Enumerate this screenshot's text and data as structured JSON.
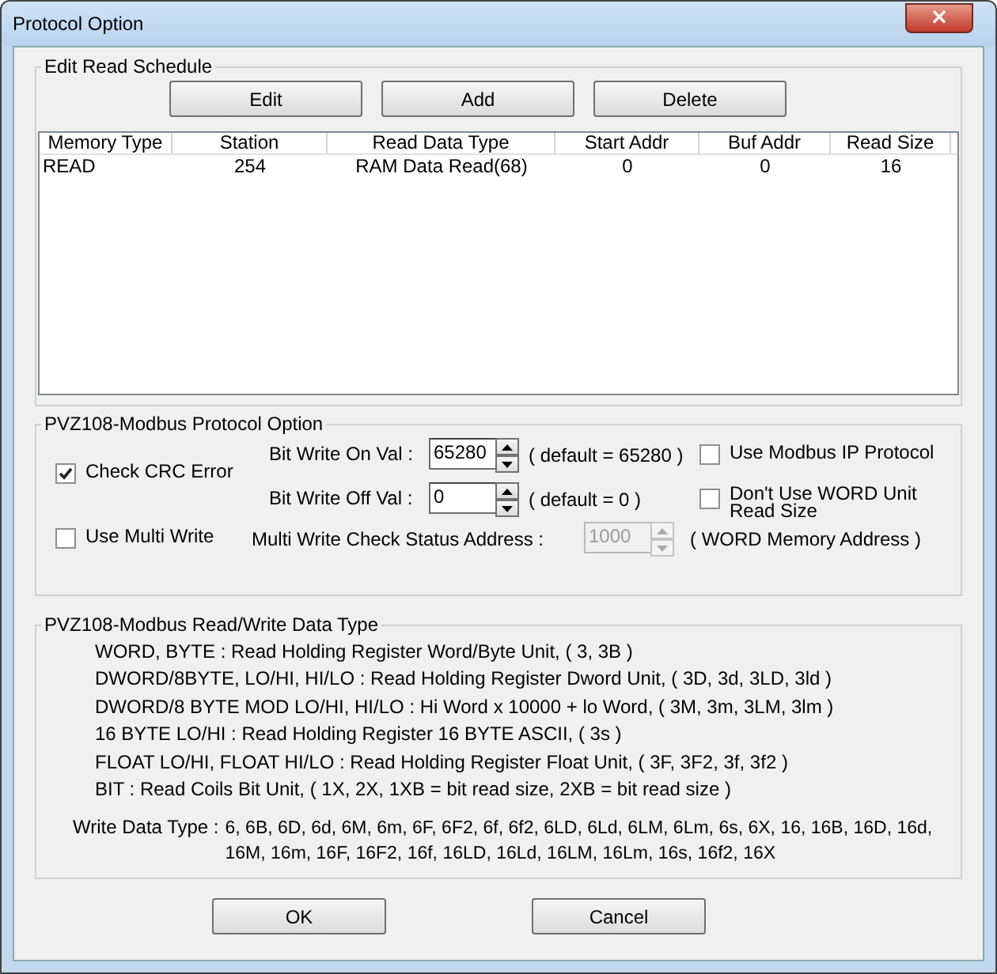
{
  "window": {
    "title": "Protocol Option",
    "close": "×"
  },
  "read_schedule": {
    "title": "Edit Read Schedule",
    "buttons": [
      "Edit",
      "Add",
      "Delete"
    ],
    "columns": [
      "Memory Type",
      "Station",
      "Read Data Type",
      "Start Addr",
      "Buf Addr",
      "Read Size"
    ],
    "rows": [
      [
        "READ",
        "254",
        "RAM Data Read(68)",
        "0",
        "0",
        "16"
      ]
    ]
  },
  "protocol_option": {
    "title": "PVZ108-Modbus Protocol Option",
    "check_crc": {
      "label": "Check CRC Error",
      "checked": true
    },
    "bit_on": {
      "label": "Bit Write On Val :",
      "value": "65280",
      "default": "( default = 65280 )"
    },
    "bit_off": {
      "label": "Bit Write Off Val :",
      "value": "0",
      "default": "( default = 0 )"
    },
    "use_ip": {
      "label": "Use Modbus IP Protocol",
      "checked": false
    },
    "no_word_unit": {
      "label": "Don't Use WORD Unit Read Size",
      "checked": false
    },
    "multi_write": {
      "label": "Use Multi Write",
      "checked": false
    },
    "status_addr": {
      "label": "Multi Write Check Status Address :",
      "value": "1000",
      "disabled": true,
      "note": "( WORD Memory Address )"
    }
  },
  "data_type": {
    "title": "PVZ108-Modbus Read/Write Data Type",
    "lines": [
      "WORD, BYTE : Read Holding Register Word/Byte Unit, ( 3, 3B )",
      "DWORD/8BYTE, LO/HI, HI/LO : Read Holding Register Dword Unit, ( 3D, 3d, 3LD, 3ld )",
      "DWORD/8 BYTE MOD LO/HI, HI/LO : Hi Word x 10000 + lo Word, ( 3M, 3m, 3LM, 3lm )",
      "16 BYTE LO/HI : Read Holding Register 16 BYTE ASCII, ( 3s )",
      "FLOAT LO/HI, FLOAT HI/LO : Read Holding Register Float Unit, ( 3F, 3F2, 3f, 3f2 )",
      "BIT : Read Coils Bit Unit, ( 1X, 2X, 1XB = bit read size, 2XB = bit read size )"
    ],
    "write_label": "Write Data Type :",
    "write_types": "6, 6B, 6D, 6d, 6M, 6m, 6F, 6F2, 6f, 6f2, 6LD, 6Ld, 6LM, 6Lm, 6s, 6X, 16, 16B, 16D, 16d, 16M, 16m, 16F, 16F2, 16f, 16LD, 16Ld, 16LM, 16Lm, 16s, 16f2, 16X"
  },
  "buttons": [
    "OK",
    "Cancel"
  ]
}
